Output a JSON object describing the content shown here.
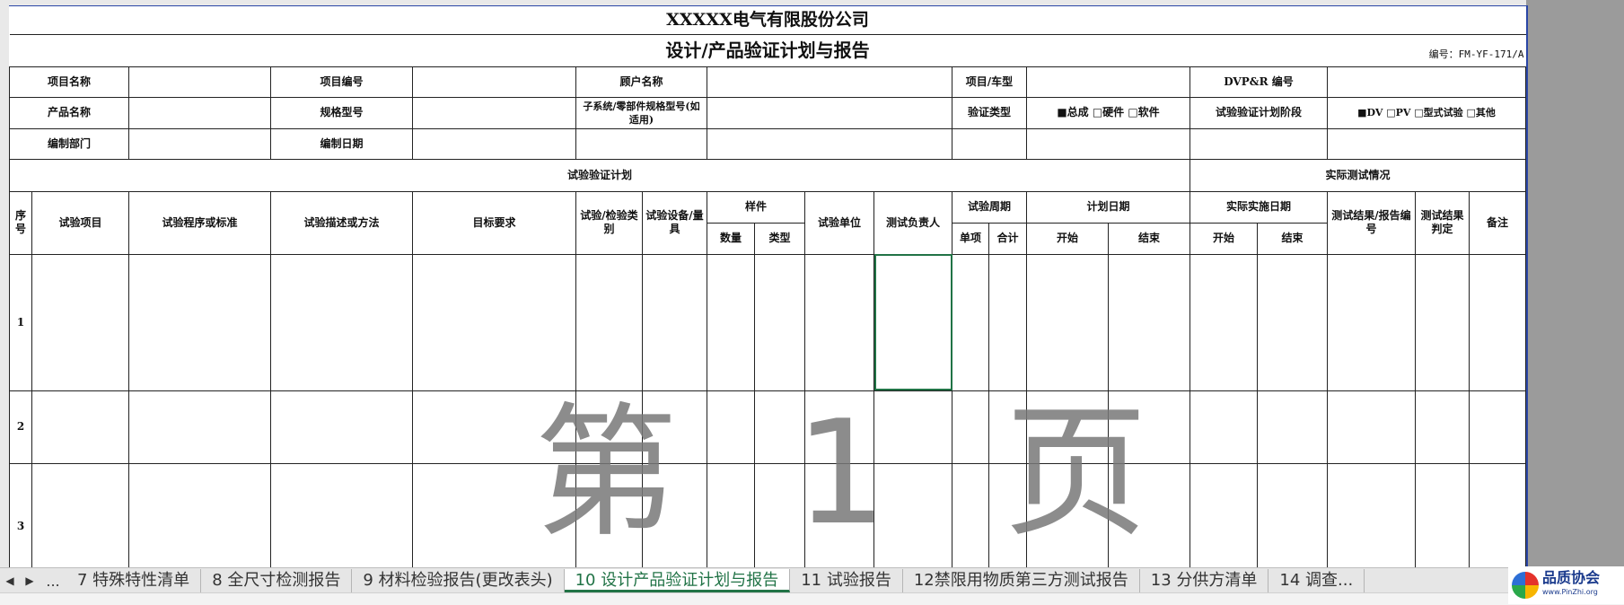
{
  "header": {
    "company": "XXXXX电气有限股份公司",
    "title": "设计/产品验证计划与报告",
    "doc_no": "编号：FM-YF-171/A"
  },
  "info": {
    "project_name_label": "项目名称",
    "project_no_label": "项目编号",
    "customer_label": "顾户名称",
    "vehicle_label": "项目/车型",
    "dvp_label": "DVP&R 编号",
    "product_label": "产品名称",
    "spec_label": "规格型号",
    "subsystem_label": "子系统/零部件规格型号(如适用)",
    "verif_type_label": "验证类型",
    "verif_type_value": "■总成 □硬件 □软件",
    "stage_label": "试验验证计划阶段",
    "stage_value": "■DV □PV □型式试验 □其他",
    "dept_label": "编制部门",
    "date_label": "编制日期"
  },
  "sections": {
    "plan": "试验验证计划",
    "actual": "实际测试情况"
  },
  "columns": {
    "seq": "序号",
    "item": "试验项目",
    "procedure": "试验程序或标准",
    "description": "试验描述或方法",
    "target": "目标要求",
    "category": "试验/检验类别",
    "equipment": "试验设备/量具",
    "sample": "样件",
    "qty": "数量",
    "type": "类型",
    "unit": "试验单位",
    "owner": "测试负责人",
    "cycle": "试验周期",
    "single": "单项",
    "total": "合计",
    "plan_date": "计划日期",
    "start": "开始",
    "end": "结束",
    "actual_date": "实际实施日期",
    "actual_start": "开始",
    "actual_end": "结束",
    "result": "测试结果/报告编号",
    "judge": "测试结果判定",
    "remark": "备注"
  },
  "rows": [
    "1",
    "2",
    "3"
  ],
  "watermark": "第 1 页",
  "tabs": {
    "more": "...",
    "items": [
      "7 特殊特性清单",
      "8 全尺寸检测报告",
      "9 材料检验报告(更改表头)",
      "10 设计产品验证计划与报告",
      "11 试验报告",
      "12禁限用物质第三方测试报告",
      "13 分供方清单",
      "14 调查..."
    ],
    "active_index": 3
  },
  "logo": {
    "name": "品质协会",
    "url": "www.PinZhi.org"
  }
}
